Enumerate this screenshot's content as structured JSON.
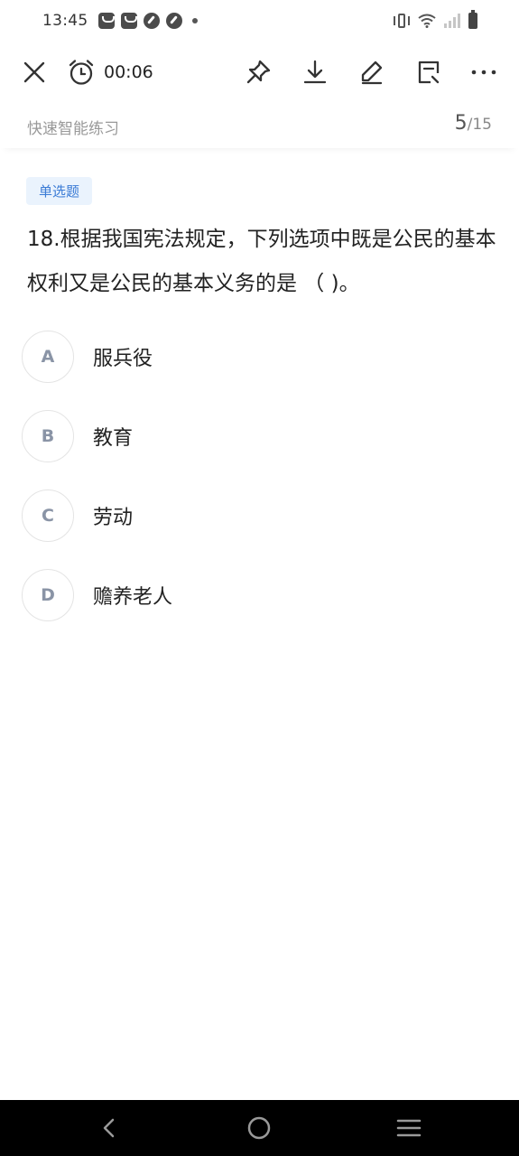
{
  "status_bar": {
    "time": "13:45"
  },
  "toolbar": {
    "timer": "00:06",
    "icons": [
      "close-icon",
      "alarm-clock-icon",
      "pin-icon",
      "download-icon",
      "edit-icon",
      "answer-sheet-icon",
      "more-icon"
    ]
  },
  "subheader": {
    "practice_name": "快速智能练习",
    "current": "5",
    "total": "/15"
  },
  "question": {
    "type": "单选题",
    "text": "18.根据我国宪法规定，下列选项中既是公民的基本权利又是公民的基本义务的是 （ )。",
    "options": [
      {
        "letter": "A",
        "text": "服兵役"
      },
      {
        "letter": "B",
        "text": "教育"
      },
      {
        "letter": "C",
        "text": "劳动"
      },
      {
        "letter": "D",
        "text": "赡养老人"
      }
    ]
  },
  "colors": {
    "accent": "#3a7bd5",
    "badge_bg": "#eaf3fd",
    "nav_bar": "#000000"
  }
}
